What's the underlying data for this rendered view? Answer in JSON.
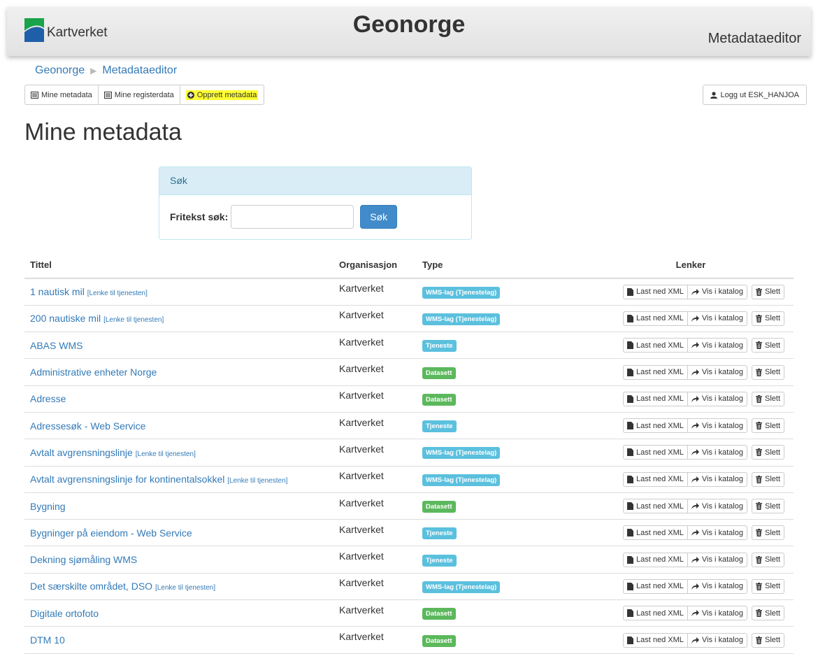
{
  "header": {
    "logo_text": "Kartverket",
    "site_title": "Geonorge",
    "app_name": "Metadataeditor"
  },
  "breadcrumb": [
    "Geonorge",
    "Metadataeditor"
  ],
  "nav": {
    "mine_metadata": "Mine metadata",
    "mine_registerdata": "Mine registerdata",
    "opprett_metadata": "Opprett metadata",
    "logout": "Logg ut ESK_HANJOA"
  },
  "page_title": "Mine metadata",
  "search": {
    "heading": "Søk",
    "label": "Fritekst søk:",
    "value": "",
    "button": "Søk"
  },
  "table": {
    "headers": {
      "title": "Tittel",
      "org": "Organisasjon",
      "type": "Type",
      "links": "Lenker"
    },
    "button_labels": {
      "download": "Last ned XML",
      "view": "Vis i katalog",
      "delete": "Slett"
    },
    "rows": [
      {
        "title": "1 nautisk mil",
        "service_link": "[Lenke til tjenesten]",
        "org": "Kartverket",
        "type": "WMS-lag (Tjenestelag)"
      },
      {
        "title": "200 nautiske mil",
        "service_link": "[Lenke til tjenesten]",
        "org": "Kartverket",
        "type": "WMS-lag (Tjenestelag)"
      },
      {
        "title": "ABAS WMS",
        "service_link": "",
        "org": "Kartverket",
        "type": "Tjeneste"
      },
      {
        "title": "Administrative enheter Norge",
        "service_link": "",
        "org": "Kartverket",
        "type": "Datasett"
      },
      {
        "title": "Adresse",
        "service_link": "",
        "org": "Kartverket",
        "type": "Datasett"
      },
      {
        "title": "Adressesøk - Web Service",
        "service_link": "",
        "org": "Kartverket",
        "type": "Tjeneste"
      },
      {
        "title": "Avtalt avgrensningslinje",
        "service_link": "[Lenke til tjenesten]",
        "org": "Kartverket",
        "type": "WMS-lag (Tjenestelag)"
      },
      {
        "title": "Avtalt avgrensningslinje for kontinentalsokkel",
        "service_link": "[Lenke til tjenesten]",
        "org": "Kartverket",
        "type": "WMS-lag (Tjenestelag)"
      },
      {
        "title": "Bygning",
        "service_link": "",
        "org": "Kartverket",
        "type": "Datasett"
      },
      {
        "title": "Bygninger på eiendom - Web Service",
        "service_link": "",
        "org": "Kartverket",
        "type": "Tjeneste"
      },
      {
        "title": "Dekning sjømåling WMS",
        "service_link": "",
        "org": "Kartverket",
        "type": "Tjeneste"
      },
      {
        "title": "Det særskilte området, DSO",
        "service_link": "[Lenke til tjenesten]",
        "org": "Kartverket",
        "type": "WMS-lag (Tjenestelag)"
      },
      {
        "title": "Digitale ortofoto",
        "service_link": "",
        "org": "Kartverket",
        "type": "Datasett"
      },
      {
        "title": "DTM 10",
        "service_link": "",
        "org": "Kartverket",
        "type": "Datasett"
      }
    ]
  },
  "colors": {
    "link": "#337ab7",
    "label_info": "#5bc0de",
    "label_success": "#5cb85c",
    "highlight": "#ffff33",
    "primary": "#428bca"
  }
}
